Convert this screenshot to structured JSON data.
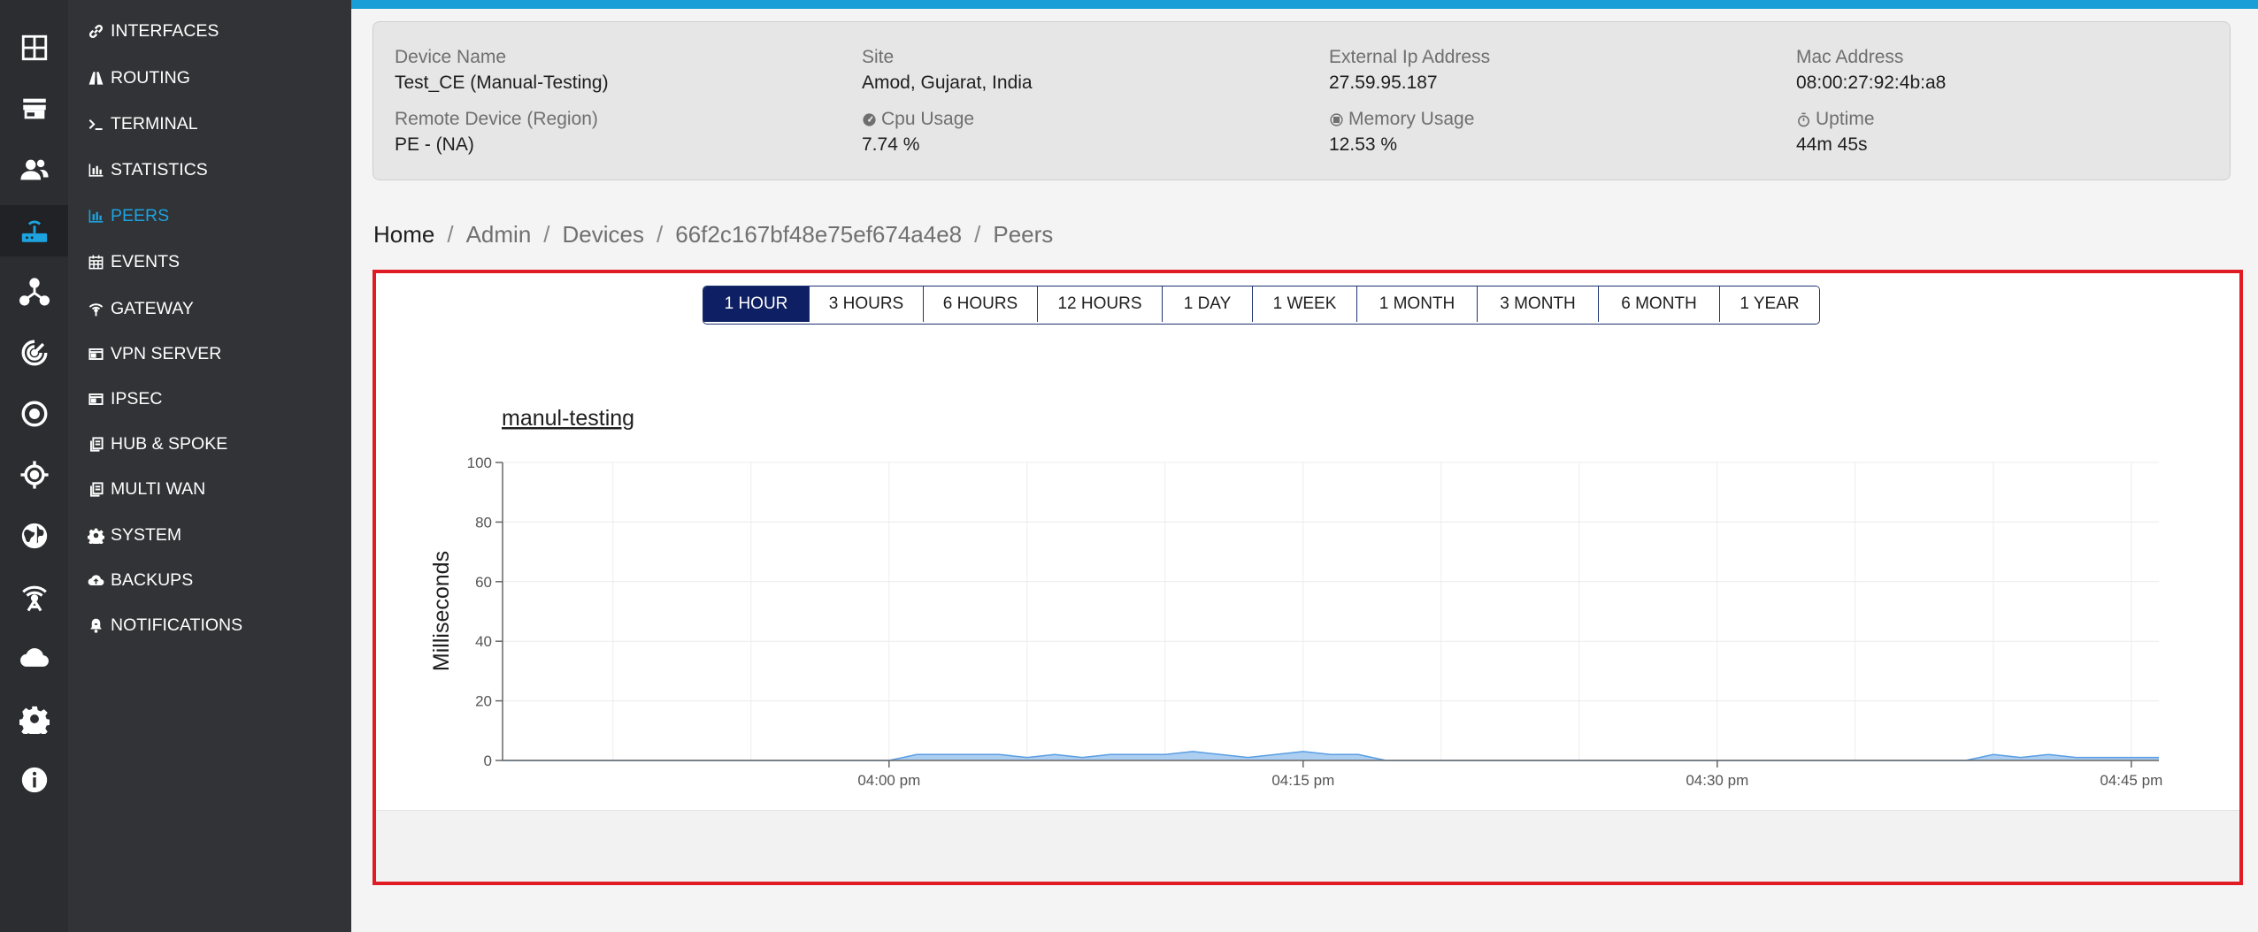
{
  "colors": {
    "accent": "#1a9ed8",
    "active_nav": "#1ca3e0",
    "range_active": "#0e1f63",
    "highlight_border": "#e01b24",
    "series_fill": "#9dc6ee",
    "series_line": "#5b9ee3"
  },
  "rail": [
    {
      "icon": "dashboard-grid-icon"
    },
    {
      "icon": "store-icon"
    },
    {
      "icon": "users-icon"
    },
    {
      "icon": "router-icon"
    },
    {
      "icon": "network-topology-icon"
    },
    {
      "icon": "radar-icon"
    },
    {
      "icon": "target-circle-icon"
    },
    {
      "icon": "crosshair-icon"
    },
    {
      "icon": "globe-icon"
    },
    {
      "icon": "antenna-icon"
    },
    {
      "icon": "cloud-icon"
    },
    {
      "icon": "gear-icon"
    },
    {
      "icon": "info-icon"
    }
  ],
  "nav": {
    "items": [
      {
        "label": "INTERFACES",
        "icon": "link-icon"
      },
      {
        "label": "ROUTING",
        "icon": "road-icon"
      },
      {
        "label": "TERMINAL",
        "icon": "terminal-icon"
      },
      {
        "label": "STATISTICS",
        "icon": "bar-chart-icon"
      },
      {
        "label": "PEERS",
        "icon": "bar-chart-icon"
      },
      {
        "label": "EVENTS",
        "icon": "calendar-icon"
      },
      {
        "label": "GATEWAY",
        "icon": "wifi-tower-icon"
      },
      {
        "label": "VPN SERVER",
        "icon": "window-icon"
      },
      {
        "label": "IPSEC",
        "icon": "window-icon"
      },
      {
        "label": "HUB & SPOKE",
        "icon": "copy-icon"
      },
      {
        "label": "MULTI WAN",
        "icon": "copy-icon"
      },
      {
        "label": "SYSTEM",
        "icon": "gear-icon"
      },
      {
        "label": "BACKUPS",
        "icon": "cloud-upload-icon"
      },
      {
        "label": "NOTIFICATIONS",
        "icon": "bell-icon"
      }
    ]
  },
  "device": {
    "device_name_label": "Device Name",
    "device_name": "Test_CE (Manual-Testing)",
    "site_label": "Site",
    "site": "Amod, Gujarat, India",
    "external_ip_label": "External Ip Address",
    "external_ip": "27.59.95.187",
    "mac_label": "Mac Address",
    "mac": "08:00:27:92:4b:a8",
    "remote_device_label": "Remote Device (Region)",
    "remote_device": "PE - (NA)",
    "cpu_label": "Cpu Usage",
    "cpu": "7.74 %",
    "memory_label": "Memory Usage",
    "memory": "12.53 %",
    "uptime_label": "Uptime",
    "uptime": "44m 45s"
  },
  "breadcrumb": {
    "home": "Home",
    "admin": "Admin",
    "devices": "Devices",
    "device_id": "66f2c167bf48e75ef674a4e8",
    "current": "Peers",
    "separator": "/"
  },
  "time_ranges": [
    "1 HOUR",
    "3 HOURS",
    "6 HOURS",
    "12 HOURS",
    "1 DAY",
    "1 WEEK",
    "1 MONTH",
    "3 MONTH",
    "6 MONTH",
    "1 YEAR"
  ],
  "active_time_range": "1 HOUR",
  "chart_data": {
    "type": "area",
    "title": "manul-testing",
    "xlabel": "",
    "ylabel": "Milliseconds",
    "ylim": [
      0,
      100
    ],
    "xlim": [
      "03:46",
      "04:46"
    ],
    "y_ticks": [
      "0",
      "20",
      "40",
      "60",
      "80",
      "100"
    ],
    "x_ticks": [
      {
        "time": "04:00",
        "label": "04:00 pm"
      },
      {
        "time": "04:15",
        "label": "04:15 pm"
      },
      {
        "time": "04:30",
        "label": "04:30 pm"
      },
      {
        "time": "04:45",
        "label": "04:45 pm"
      }
    ],
    "grid": true,
    "legend": "none",
    "series": [
      {
        "x": [
          "03:46",
          "04:00",
          "04:01",
          "04:02",
          "04:03",
          "04:04",
          "04:05",
          "04:06",
          "04:07",
          "04:08",
          "04:09",
          "04:10",
          "04:11",
          "04:12",
          "04:13",
          "04:14",
          "04:15",
          "04:16",
          "04:17",
          "04:18",
          "04:19",
          "04:20",
          "04:25",
          "04:30",
          "04:35",
          "04:39",
          "04:40",
          "04:41",
          "04:42",
          "04:43",
          "04:44",
          "04:45",
          "04:46"
        ],
        "y": [
          0,
          0,
          2,
          2,
          2,
          2,
          1,
          2,
          1,
          2,
          2,
          2,
          3,
          2,
          1,
          2,
          3,
          2,
          2,
          0,
          0,
          0,
          0,
          0,
          0,
          0,
          2,
          1,
          2,
          1,
          1,
          1,
          1
        ]
      }
    ]
  }
}
